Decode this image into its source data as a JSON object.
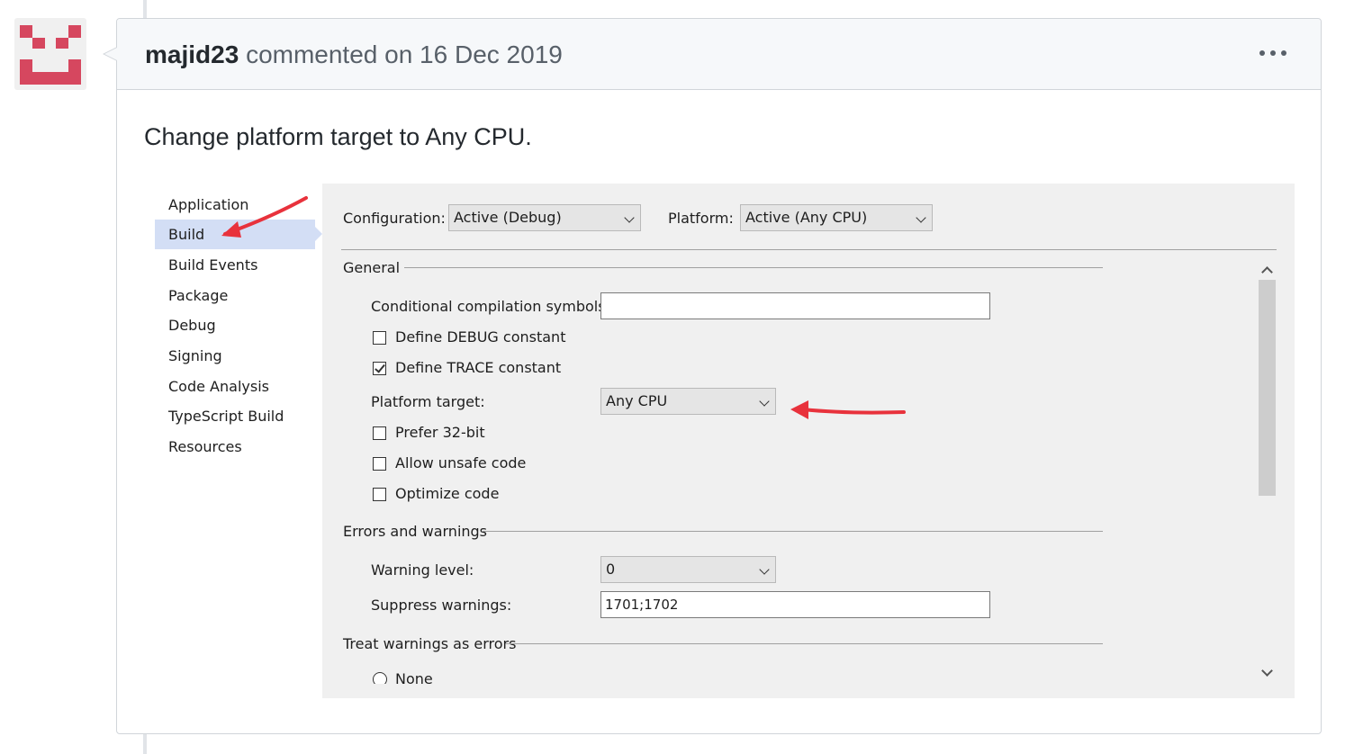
{
  "comment": {
    "author": "majid23",
    "meta": "commented on 16 Dec 2019",
    "body": "Change platform target to Any CPU."
  },
  "colors": {
    "avatar": "#d6475f",
    "arrow": "#e8323c",
    "selection": "#d3def5"
  },
  "screenshot": {
    "sidebar": [
      "Application",
      "Build",
      "Build Events",
      "Package",
      "Debug",
      "Signing",
      "Code Analysis",
      "TypeScript Build",
      "Resources"
    ],
    "selected": "Build",
    "configuration_label": "Configuration:",
    "configuration_value": "Active (Debug)",
    "platform_label": "Platform:",
    "platform_value": "Active (Any CPU)",
    "general_header": "General",
    "cond_symbols_label": "Conditional compilation symbols:",
    "cond_symbols_value": "",
    "define_debug": "Define DEBUG constant",
    "define_trace": "Define TRACE constant",
    "platform_target_label": "Platform target:",
    "platform_target_value": "Any CPU",
    "prefer32": "Prefer 32-bit",
    "allow_unsafe": "Allow unsafe code",
    "optimize": "Optimize code",
    "errors_header": "Errors and warnings",
    "warning_level_label": "Warning level:",
    "warning_level_value": "0",
    "suppress_label": "Suppress warnings:",
    "suppress_value": "1701;1702",
    "treat_header": "Treat warnings as errors",
    "none_option": "None"
  }
}
